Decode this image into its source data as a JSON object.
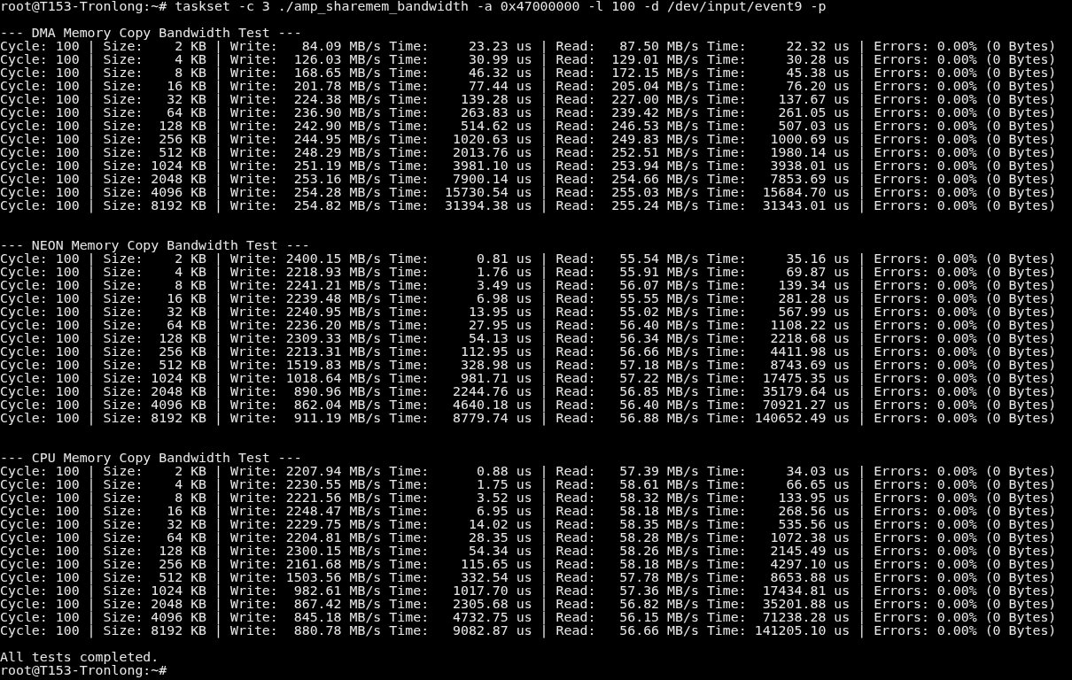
{
  "terminal": {
    "command_line": "root@T153-Tronlong:~# taskset -c 3 ./amp_sharemem_bandwidth -a 0x47000000 -l 100 -d /dev/input/event9 -p",
    "sections": [
      {
        "title": "--- DMA Memory Copy Bandwidth Test ---",
        "lines": [
          "Cycle: 100 | Size:    2 KB | Write:   84.09 MB/s Time:     23.23 us | Read:   87.50 MB/s Time:     22.32 us | Errors: 0.00% (0 Bytes)",
          "Cycle: 100 | Size:    4 KB | Write:  126.03 MB/s Time:     30.99 us | Read:  129.01 MB/s Time:     30.28 us | Errors: 0.00% (0 Bytes)",
          "Cycle: 100 | Size:    8 KB | Write:  168.65 MB/s Time:     46.32 us | Read:  172.15 MB/s Time:     45.38 us | Errors: 0.00% (0 Bytes)",
          "Cycle: 100 | Size:   16 KB | Write:  201.78 MB/s Time:     77.44 us | Read:  205.04 MB/s Time:     76.20 us | Errors: 0.00% (0 Bytes)",
          "Cycle: 100 | Size:   32 KB | Write:  224.38 MB/s Time:    139.28 us | Read:  227.00 MB/s Time:    137.67 us | Errors: 0.00% (0 Bytes)",
          "Cycle: 100 | Size:   64 KB | Write:  236.90 MB/s Time:    263.83 us | Read:  239.42 MB/s Time:    261.05 us | Errors: 0.00% (0 Bytes)",
          "Cycle: 100 | Size:  128 KB | Write:  242.90 MB/s Time:    514.62 us | Read:  246.53 MB/s Time:    507.03 us | Errors: 0.00% (0 Bytes)",
          "Cycle: 100 | Size:  256 KB | Write:  244.95 MB/s Time:   1020.63 us | Read:  249.83 MB/s Time:   1000.69 us | Errors: 0.00% (0 Bytes)",
          "Cycle: 100 | Size:  512 KB | Write:  248.29 MB/s Time:   2013.76 us | Read:  252.51 MB/s Time:   1980.14 us | Errors: 0.00% (0 Bytes)",
          "Cycle: 100 | Size: 1024 KB | Write:  251.19 MB/s Time:   3981.10 us | Read:  253.94 MB/s Time:   3938.01 us | Errors: 0.00% (0 Bytes)",
          "Cycle: 100 | Size: 2048 KB | Write:  253.16 MB/s Time:   7900.14 us | Read:  254.66 MB/s Time:   7853.69 us | Errors: 0.00% (0 Bytes)",
          "Cycle: 100 | Size: 4096 KB | Write:  254.28 MB/s Time:  15730.54 us | Read:  255.03 MB/s Time:  15684.70 us | Errors: 0.00% (0 Bytes)",
          "Cycle: 100 | Size: 8192 KB | Write:  254.82 MB/s Time:  31394.38 us | Read:  255.24 MB/s Time:  31343.01 us | Errors: 0.00% (0 Bytes)"
        ]
      },
      {
        "title": "--- NEON Memory Copy Bandwidth Test ---",
        "lines": [
          "Cycle: 100 | Size:    2 KB | Write: 2400.15 MB/s Time:      0.81 us | Read:   55.54 MB/s Time:     35.16 us | Errors: 0.00% (0 Bytes)",
          "Cycle: 100 | Size:    4 KB | Write: 2218.93 MB/s Time:      1.76 us | Read:   55.91 MB/s Time:     69.87 us | Errors: 0.00% (0 Bytes)",
          "Cycle: 100 | Size:    8 KB | Write: 2241.21 MB/s Time:      3.49 us | Read:   56.07 MB/s Time:    139.34 us | Errors: 0.00% (0 Bytes)",
          "Cycle: 100 | Size:   16 KB | Write: 2239.48 MB/s Time:      6.98 us | Read:   55.55 MB/s Time:    281.28 us | Errors: 0.00% (0 Bytes)",
          "Cycle: 100 | Size:   32 KB | Write: 2240.95 MB/s Time:     13.95 us | Read:   55.02 MB/s Time:    567.99 us | Errors: 0.00% (0 Bytes)",
          "Cycle: 100 | Size:   64 KB | Write: 2236.20 MB/s Time:     27.95 us | Read:   56.40 MB/s Time:   1108.22 us | Errors: 0.00% (0 Bytes)",
          "Cycle: 100 | Size:  128 KB | Write: 2309.33 MB/s Time:     54.13 us | Read:   56.34 MB/s Time:   2218.68 us | Errors: 0.00% (0 Bytes)",
          "Cycle: 100 | Size:  256 KB | Write: 2213.31 MB/s Time:    112.95 us | Read:   56.66 MB/s Time:   4411.98 us | Errors: 0.00% (0 Bytes)",
          "Cycle: 100 | Size:  512 KB | Write: 1519.83 MB/s Time:    328.98 us | Read:   57.18 MB/s Time:   8743.69 us | Errors: 0.00% (0 Bytes)",
          "Cycle: 100 | Size: 1024 KB | Write: 1018.64 MB/s Time:    981.71 us | Read:   57.22 MB/s Time:  17475.35 us | Errors: 0.00% (0 Bytes)",
          "Cycle: 100 | Size: 2048 KB | Write:  890.96 MB/s Time:   2244.76 us | Read:   56.85 MB/s Time:  35179.64 us | Errors: 0.00% (0 Bytes)",
          "Cycle: 100 | Size: 4096 KB | Write:  862.04 MB/s Time:   4640.18 us | Read:   56.40 MB/s Time:  70921.27 us | Errors: 0.00% (0 Bytes)",
          "Cycle: 100 | Size: 8192 KB | Write:  911.19 MB/s Time:   8779.74 us | Read:   56.88 MB/s Time: 140652.49 us | Errors: 0.00% (0 Bytes)"
        ]
      },
      {
        "title": "--- CPU Memory Copy Bandwidth Test ---",
        "lines": [
          "Cycle: 100 | Size:    2 KB | Write: 2207.94 MB/s Time:      0.88 us | Read:   57.39 MB/s Time:     34.03 us | Errors: 0.00% (0 Bytes)",
          "Cycle: 100 | Size:    4 KB | Write: 2230.55 MB/s Time:      1.75 us | Read:   58.61 MB/s Time:     66.65 us | Errors: 0.00% (0 Bytes)",
          "Cycle: 100 | Size:    8 KB | Write: 2221.56 MB/s Time:      3.52 us | Read:   58.32 MB/s Time:    133.95 us | Errors: 0.00% (0 Bytes)",
          "Cycle: 100 | Size:   16 KB | Write: 2248.47 MB/s Time:      6.95 us | Read:   58.18 MB/s Time:    268.56 us | Errors: 0.00% (0 Bytes)",
          "Cycle: 100 | Size:   32 KB | Write: 2229.75 MB/s Time:     14.02 us | Read:   58.35 MB/s Time:    535.56 us | Errors: 0.00% (0 Bytes)",
          "Cycle: 100 | Size:   64 KB | Write: 2204.81 MB/s Time:     28.35 us | Read:   58.28 MB/s Time:   1072.38 us | Errors: 0.00% (0 Bytes)",
          "Cycle: 100 | Size:  128 KB | Write: 2300.15 MB/s Time:     54.34 us | Read:   58.26 MB/s Time:   2145.49 us | Errors: 0.00% (0 Bytes)",
          "Cycle: 100 | Size:  256 KB | Write: 2161.68 MB/s Time:    115.65 us | Read:   58.18 MB/s Time:   4297.10 us | Errors: 0.00% (0 Bytes)",
          "Cycle: 100 | Size:  512 KB | Write: 1503.56 MB/s Time:    332.54 us | Read:   57.78 MB/s Time:   8653.88 us | Errors: 0.00% (0 Bytes)",
          "Cycle: 100 | Size: 1024 KB | Write:  982.61 MB/s Time:   1017.70 us | Read:   57.36 MB/s Time:  17434.81 us | Errors: 0.00% (0 Bytes)",
          "Cycle: 100 | Size: 2048 KB | Write:  867.42 MB/s Time:   2305.68 us | Read:   56.82 MB/s Time:  35201.88 us | Errors: 0.00% (0 Bytes)",
          "Cycle: 100 | Size: 4096 KB | Write:  845.18 MB/s Time:   4732.75 us | Read:   56.15 MB/s Time:  71238.28 us | Errors: 0.00% (0 Bytes)",
          "Cycle: 100 | Size: 8192 KB | Write:  880.78 MB/s Time:   9082.87 us | Read:   56.66 MB/s Time: 141205.10 us | Errors: 0.00% (0 Bytes)"
        ]
      }
    ],
    "completion_message": "All tests completed.",
    "final_prompt": "root@T153-Tronlong:~#"
  }
}
